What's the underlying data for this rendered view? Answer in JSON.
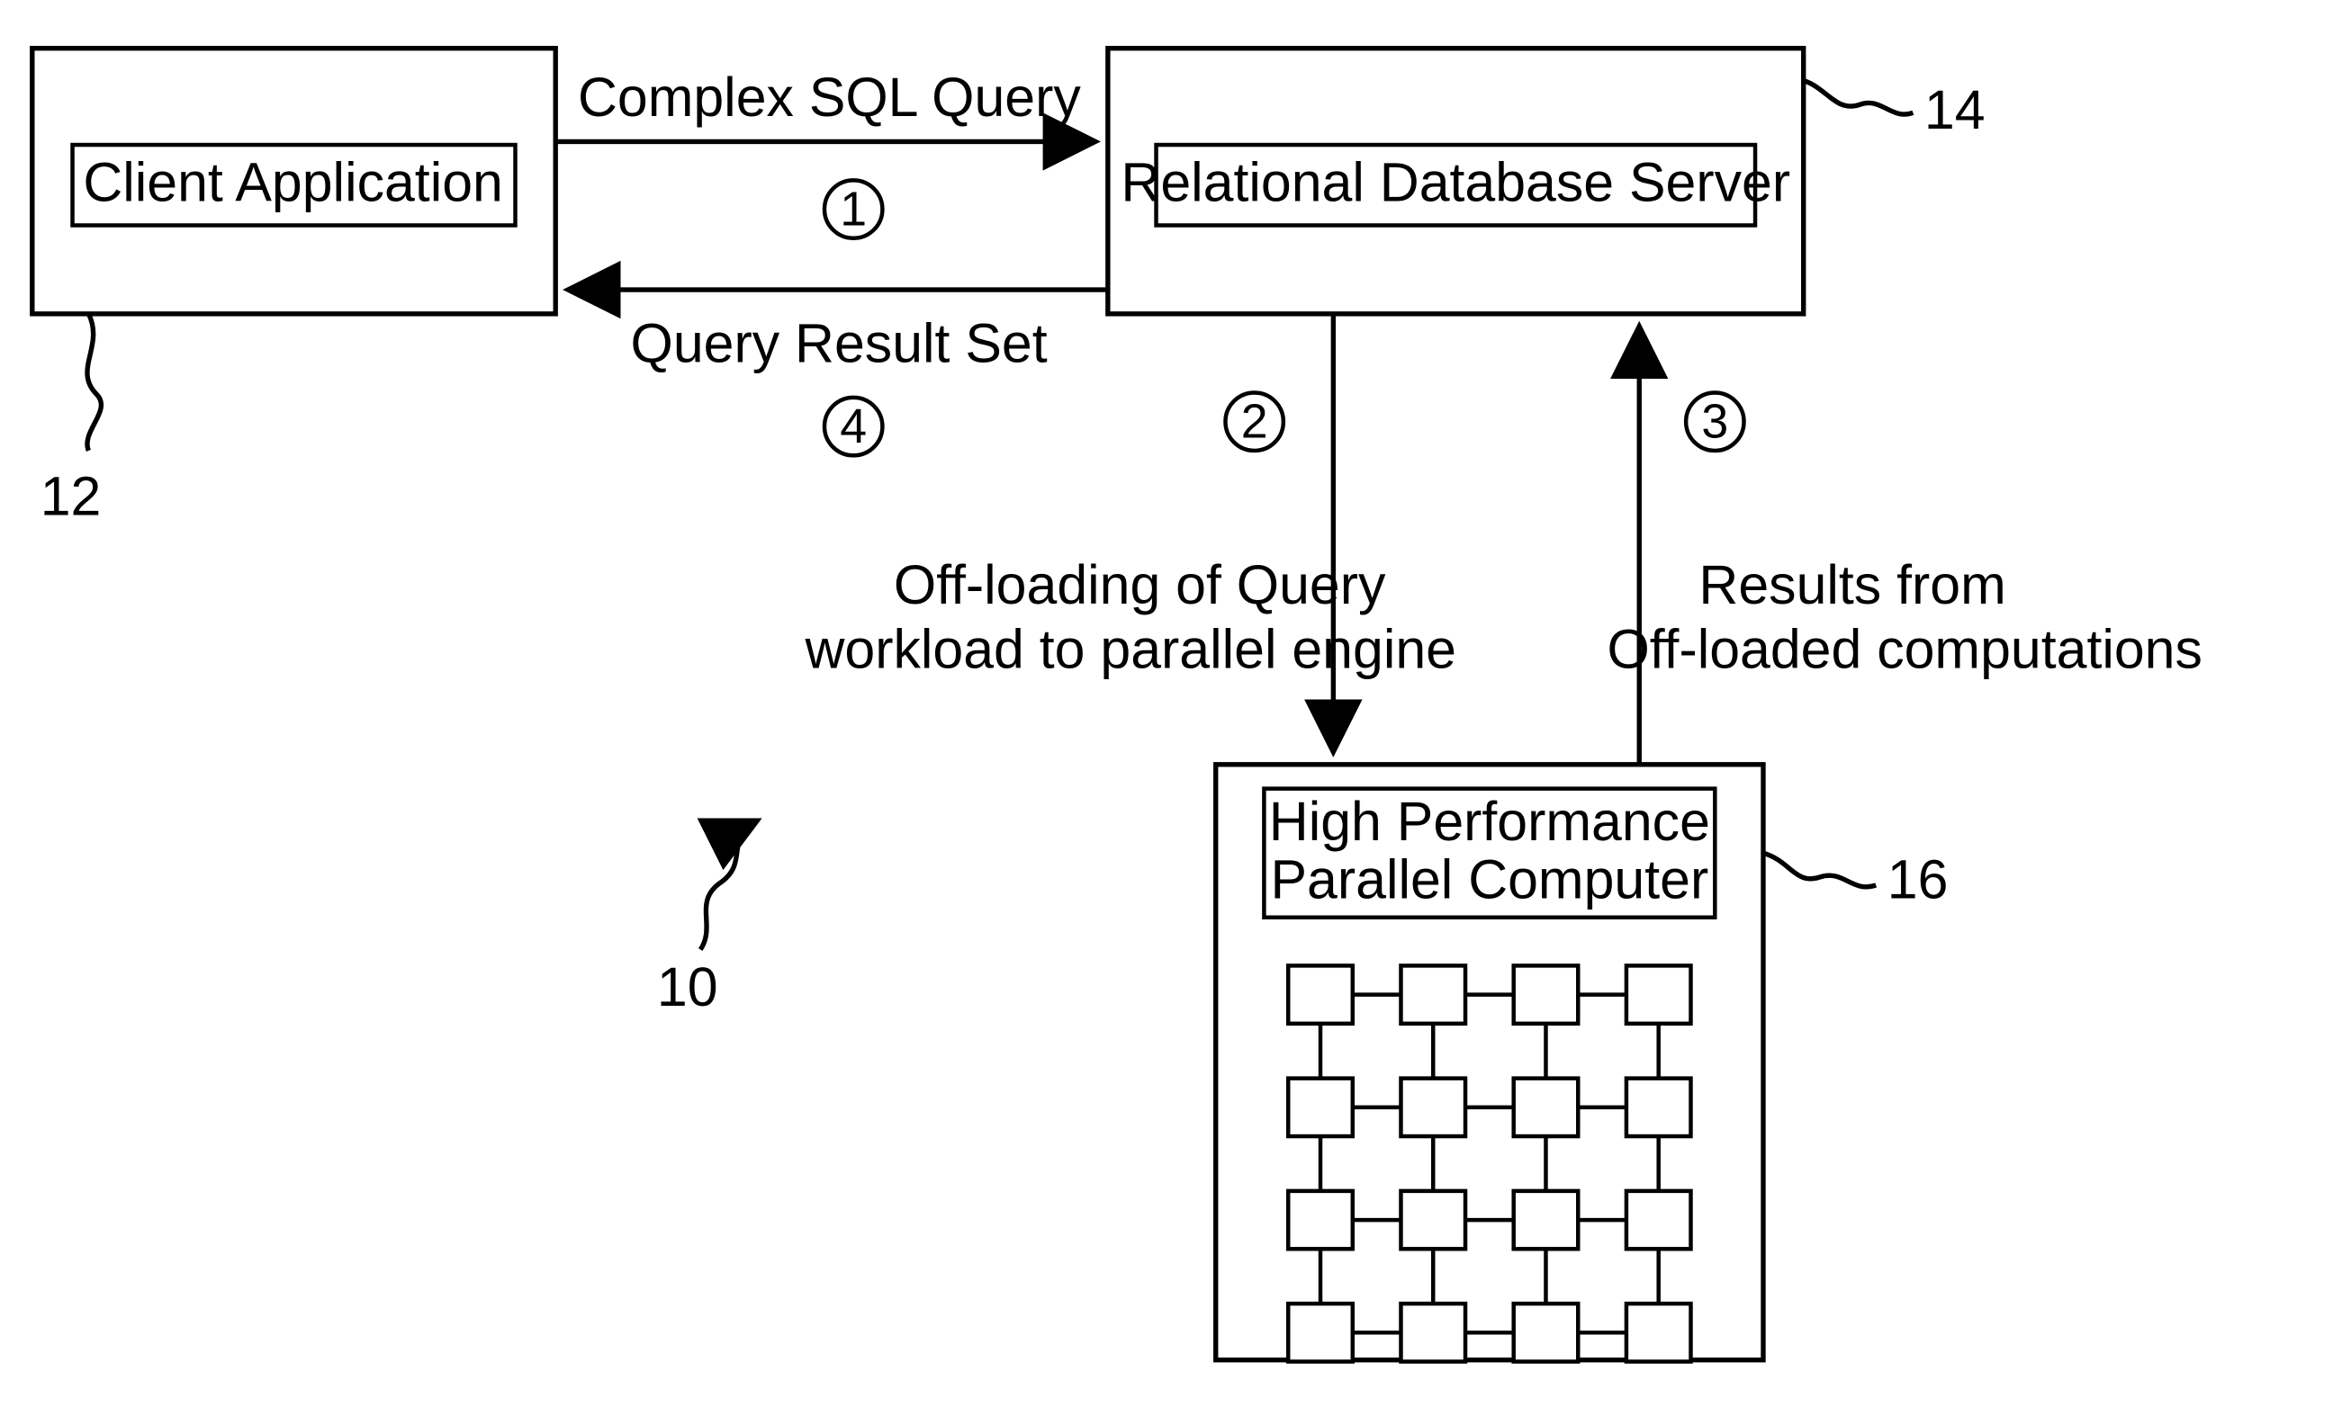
{
  "nodes": {
    "client": "Client Application",
    "server": "Relational Database Server",
    "hpc_l1": "High Performance",
    "hpc_l2": "Parallel Computer"
  },
  "edges": {
    "e1_label": "Complex SQL Query",
    "e1_num": "1",
    "e4_label": "Query Result Set",
    "e4_num": "4",
    "e2_num": "2",
    "e2_l1": "Off-loading of Query",
    "e2_l2": "workload to parallel engine",
    "e3_num": "3",
    "e3_l1": "Results from",
    "e3_l2": "Off-loaded computations"
  },
  "refs": {
    "r10": "10",
    "r12": "12",
    "r14": "14",
    "r16": "16"
  }
}
